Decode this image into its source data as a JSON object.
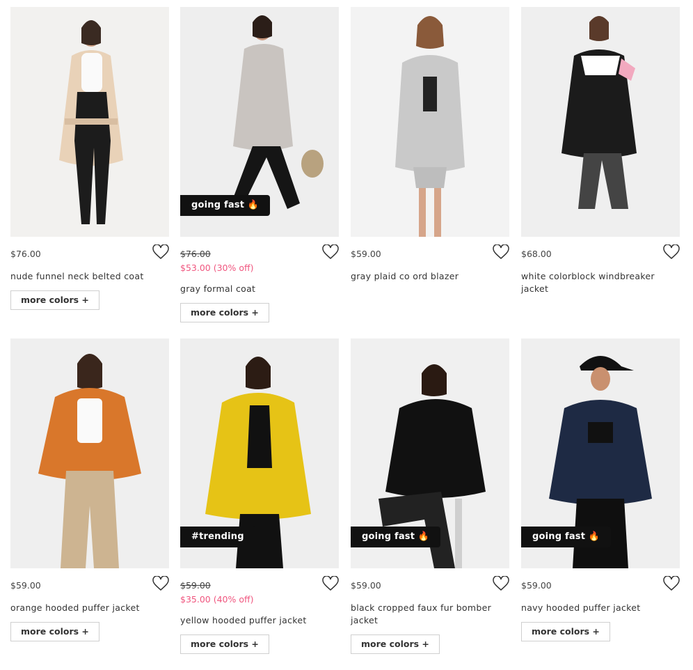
{
  "products": [
    {
      "price": "$76.00",
      "name": "nude funnel neck belted coat",
      "more": "more colors +",
      "badge": "",
      "old": false,
      "sale": ""
    },
    {
      "price": "$76.00",
      "name": "gray formal coat",
      "more": "more colors +",
      "badge": "going fast 🔥",
      "old": true,
      "sale": "$53.00 (30% off)"
    },
    {
      "price": "$59.00",
      "name": "gray plaid co ord blazer",
      "more": "",
      "badge": "",
      "old": false,
      "sale": ""
    },
    {
      "price": "$68.00",
      "name": "white colorblock windbreaker jacket",
      "more": "",
      "badge": "",
      "old": false,
      "sale": ""
    },
    {
      "price": "$59.00",
      "name": "orange hooded puffer jacket",
      "more": "more colors +",
      "badge": "",
      "old": false,
      "sale": ""
    },
    {
      "price": "$59.00",
      "name": "yellow hooded puffer jacket",
      "more": "more colors +",
      "badge": "#trending",
      "old": true,
      "sale": "$35.00 (40% off)"
    },
    {
      "price": "$59.00",
      "name": "black cropped faux fur bomber jacket",
      "more": "more colors +",
      "badge": "going fast 🔥",
      "old": false,
      "sale": ""
    },
    {
      "price": "$59.00",
      "name": "navy hooded puffer jacket",
      "more": "more colors +",
      "badge": "going fast 🔥",
      "old": false,
      "sale": ""
    }
  ],
  "colors": {
    "sale": "#f0567f",
    "badge_bg": "#111111"
  },
  "icons": {
    "wishlist": "heart-icon"
  }
}
